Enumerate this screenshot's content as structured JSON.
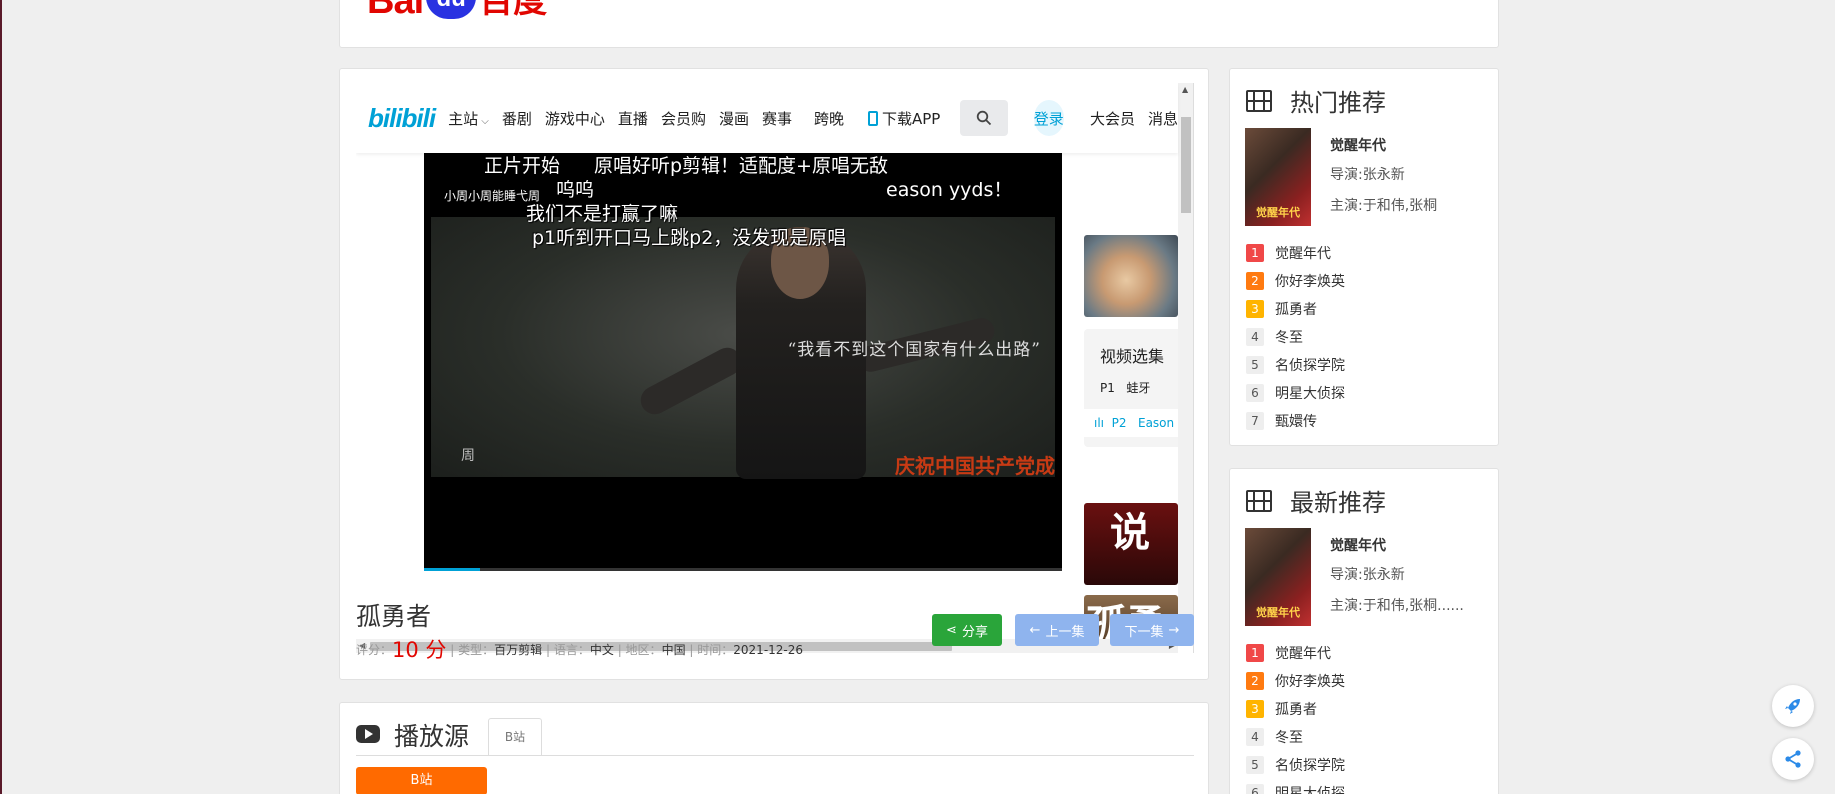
{
  "logo": {
    "part1": "Bai",
    "part2": "du",
    "part3": "百度"
  },
  "bili": {
    "logo": "bilibili",
    "nav": [
      "主站",
      "番剧",
      "游戏中心",
      "直播",
      "会员购",
      "漫画",
      "赛事",
      "跨晚"
    ],
    "download_app": "下载APP",
    "login": "登录",
    "nav_right": [
      "大会员",
      "消息"
    ]
  },
  "danmaku": [
    "正片开始",
    "原唱好听p剪辑！适配度+原唱无敌",
    "呜呜",
    "小周小周能睡弋周",
    "eason yyds！",
    "我们不是打赢了嘛",
    "p1听到开口马上跳p2，没发现是原唱"
  ],
  "video_overlay": {
    "quote": "“我看不到这个国家有什么出路”",
    "red_caption": "庆祝中国共产党成",
    "signature": "周"
  },
  "episodes": {
    "title": "视频选集",
    "items": [
      {
        "num": "P1",
        "name": "蛙牙"
      },
      {
        "num": "P2",
        "name": "Eason"
      }
    ]
  },
  "side_thumbs": [
    "说",
    "孤勇"
  ],
  "video": {
    "title": "孤勇者",
    "score_label": "评分：",
    "score": "10 分",
    "type_label": "类型：",
    "type": "百万剪辑",
    "lang_label": "语言：",
    "lang": "中文",
    "region_label": "地区：",
    "region": "中国",
    "time_label": "时间：",
    "time": "2021-12-26"
  },
  "buttons": {
    "share": "分享",
    "prev": "上一集",
    "next": "下一集"
  },
  "source": {
    "title": "播放源",
    "tab": "B站",
    "button": "B站"
  },
  "hot": {
    "title": "热门推荐",
    "poster_text": "觉醒年代",
    "featured": {
      "title": "觉醒年代",
      "director": "导演:张永新",
      "actors": "主演:于和伟,张桐"
    },
    "list": [
      "觉醒年代",
      "你好李焕英",
      "孤勇者",
      "冬至",
      "名侦探学院",
      "明星大侦探",
      "甄嬛传"
    ]
  },
  "latest": {
    "title": "最新推荐",
    "poster_text": "觉醒年代",
    "featured": {
      "title": "觉醒年代",
      "director": "导演:张永新",
      "actors": "主演:于和伟,张桐......"
    },
    "list": [
      "觉醒年代",
      "你好李焕英",
      "孤勇者",
      "冬至",
      "名侦探学院",
      "明星大侦探"
    ]
  },
  "colors": {
    "bili_blue": "#00a1d6",
    "baidu_red": "#e10601",
    "baidu_blue": "#2932e1",
    "share_green": "#2aa53a",
    "source_orange": "#ff6a00"
  }
}
